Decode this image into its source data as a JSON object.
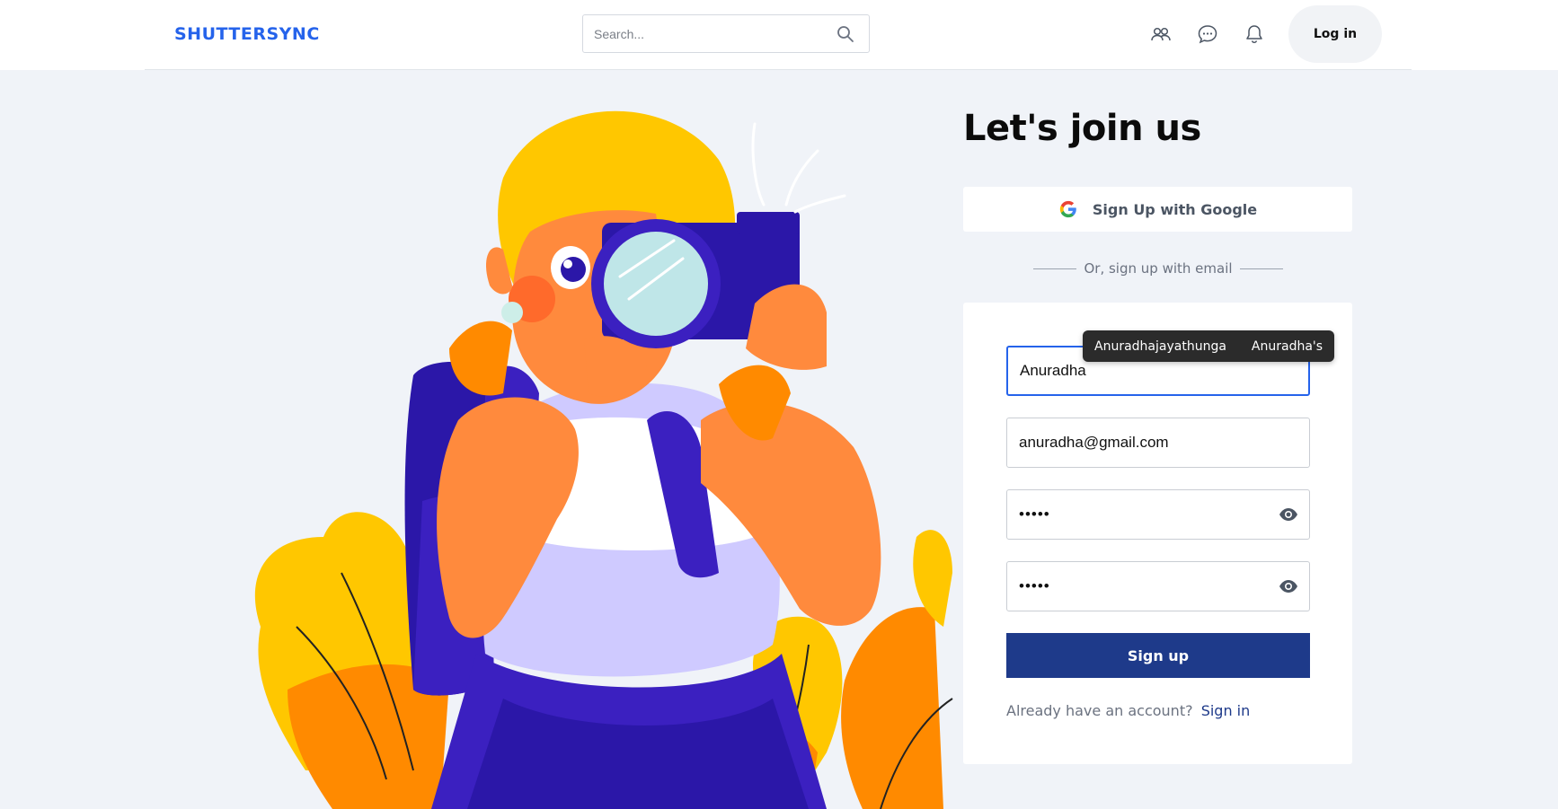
{
  "header": {
    "logo": "SHUTTERSYNC",
    "search_placeholder": "Search...",
    "login_label": "Log in",
    "icons": [
      "users-icon",
      "chat-icon",
      "bell-icon",
      "search-icon"
    ]
  },
  "signup": {
    "title": "Let's join us",
    "google_label": "Sign Up with Google",
    "divider_text": "Or, sign up with email",
    "fields": {
      "username_value": "Anuradha",
      "email_value": "anuradha@gmail.com",
      "password_value": "•••••",
      "confirm_password_value": "•••••"
    },
    "signup_label": "Sign up",
    "already_text": "Already have an account?",
    "signin_link": "Sign in"
  },
  "autocomplete": {
    "options": [
      "Anuradhajayathunga",
      "Anuradha's"
    ]
  },
  "colors": {
    "brand": "#2563eb",
    "primary_button": "#1e3a8a",
    "background": "#f0f3f8"
  }
}
